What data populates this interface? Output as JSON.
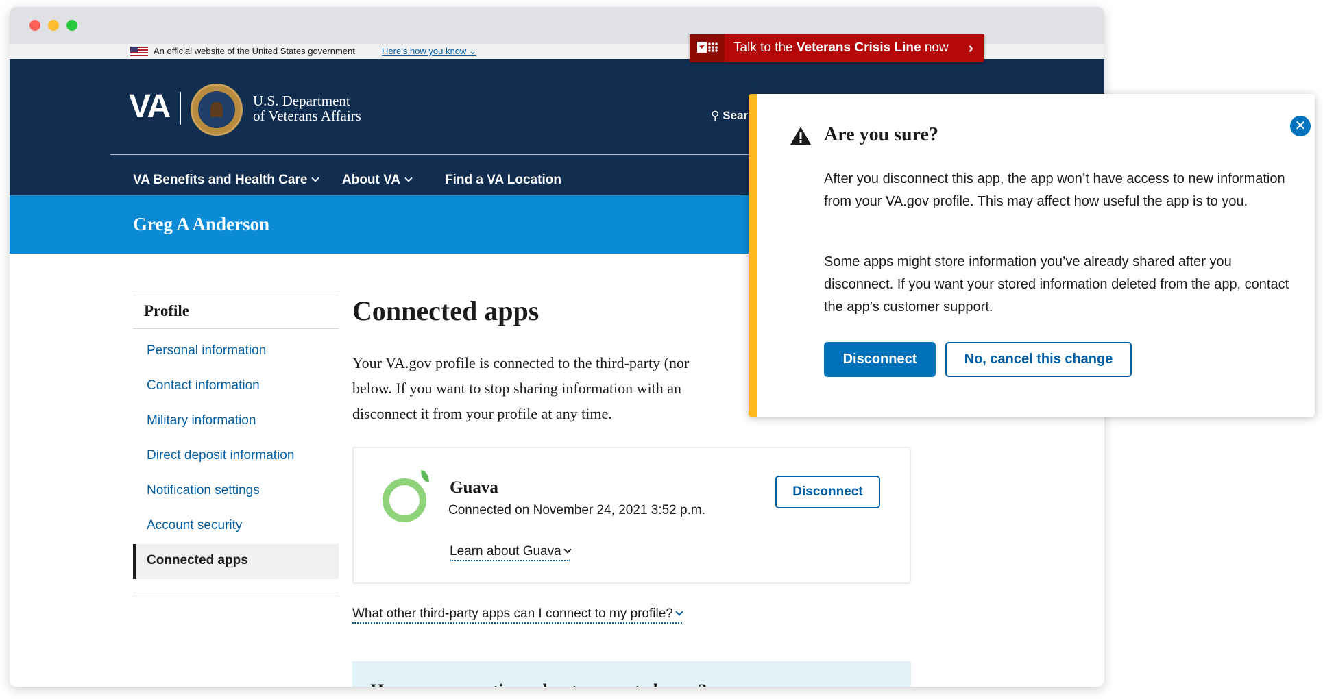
{
  "gov_banner": {
    "text": "An official website of the United States government",
    "link": "Here’s how you know"
  },
  "crisis_line": {
    "prefix": "Talk to the ",
    "emphasis": "Veterans Crisis Line",
    "suffix": " now",
    "color": "#b50909"
  },
  "header": {
    "logo": "VA",
    "dept_line1": "U.S. Department",
    "dept_line2": "of Veterans Affairs",
    "search": "Sear",
    "nav": [
      {
        "label": "VA Benefits and Health Care"
      },
      {
        "label": "About VA"
      },
      {
        "label": "Find a VA Location"
      }
    ],
    "color": "#112e51"
  },
  "user": {
    "name": "Greg A Anderson",
    "bar_color": "#0b8bd6"
  },
  "sidenav": {
    "title": "Profile",
    "items": [
      {
        "label": "Personal information"
      },
      {
        "label": "Contact information"
      },
      {
        "label": "Military information"
      },
      {
        "label": "Direct deposit information"
      },
      {
        "label": "Notification settings"
      },
      {
        "label": "Account security"
      },
      {
        "label": "Connected apps"
      }
    ]
  },
  "main": {
    "title": "Connected apps",
    "intro": "Your VA.gov profile is connected to the third-party (nor below. If you want to stop sharing information with an disconnect it from your profile at any time.",
    "intro_lines": [
      "Your VA.gov profile is connected to the third-party (nor",
      "below. If you want to stop sharing information with an",
      "disconnect it from your profile at any time."
    ],
    "app": {
      "name": "Guava",
      "connected": "Connected on November 24, 2021 3:52 p.m.",
      "learn": "Learn about Guava",
      "disconnect": "Disconnect"
    },
    "other_apps": "What other third-party apps can I connect to my profile?",
    "faq_heading": "Have more questions about connected apps?"
  },
  "modal": {
    "title": "Are you sure?",
    "p1": "After you disconnect this app, the app won’t have access to new information from your VA.gov profile. This may affect how useful the app is to you.",
    "p2": "Some apps might store information you’ve already shared after you disconnect. If you want your stored information deleted from the app, contact the app’s customer support.",
    "primary": "Disconnect",
    "secondary": "No, cancel this change",
    "accent": "#fdb81e",
    "button_color": "#0071bb"
  }
}
